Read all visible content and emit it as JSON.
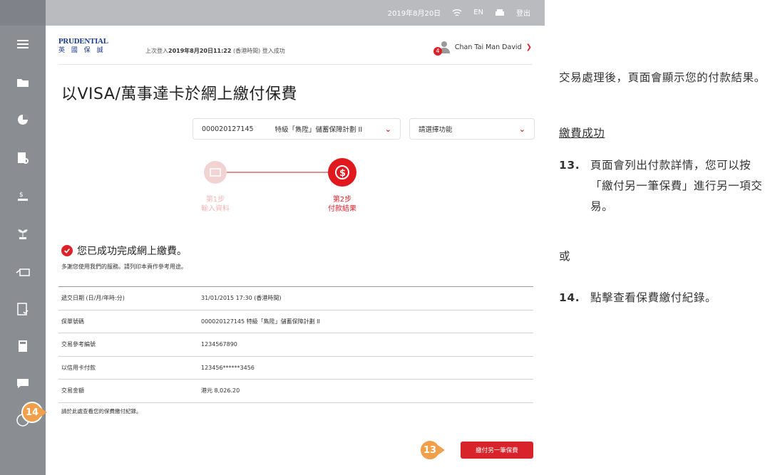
{
  "topbar": {
    "date": "2019年8月20日",
    "lang": "EN",
    "logout": "登出"
  },
  "header": {
    "logo_en": "PRUDENTIAL",
    "logo_zh": "英 國 保 誠",
    "last_login_prefix": "上次登入",
    "last_login_time": "2019年8月20日11:22",
    "last_login_suffix": "(香港時間) 登入成功",
    "user_name": "Chan Tai Man David",
    "notification_count": "4"
  },
  "page": {
    "title": "以VISA/萬事達卡於網上繳付保費",
    "policy_number": "000020127145",
    "policy_name": "特級「雋陞」儲蓄保障計劃 II",
    "function_placeholder": "請選擇功能"
  },
  "steps": [
    {
      "num": "第1步",
      "label": "輸入資料"
    },
    {
      "num": "第2步",
      "label": "付款結果"
    }
  ],
  "result": {
    "headline": "您已成功完成網上繳費。",
    "thanks": "多謝您使用我們的服務。請列印本頁作參考用途。",
    "rows": [
      {
        "key": "遞交日期 (日/月/年時:分)",
        "value": "31/01/2015 17:30 (香港時間)"
      },
      {
        "key": "保單號碼",
        "value": "000020127145 特級「雋陞」儲蓄保障計劃 II"
      },
      {
        "key": "交易參考編號",
        "value": "1234567890"
      },
      {
        "key": "以信用卡付款",
        "value": "123456******3456"
      },
      {
        "key": "交易金額",
        "value": "港元 8,026.20"
      }
    ],
    "history_hint": "請於此處查看您的保費繳付紀錄。",
    "pay_another_button": "繳付另一筆保費"
  },
  "callouts": {
    "c14": "14",
    "c13": "13"
  },
  "instructions": {
    "intro": "交易處理後，頁面會顯示您的付款結果。",
    "heading": "繳費成功",
    "item13_num": "13.",
    "item13_text": "頁面會列出付款詳情，您可以按「繳付另一筆保費」進行另一項交易。",
    "or": "或",
    "item14_num": "14.",
    "item14_text": "點擊查看保費繳付紀錄。"
  },
  "colors": {
    "brand_red": "#d9232a",
    "callout_orange": "#f0a04b",
    "sidebar_grey": "#8a8d92"
  }
}
